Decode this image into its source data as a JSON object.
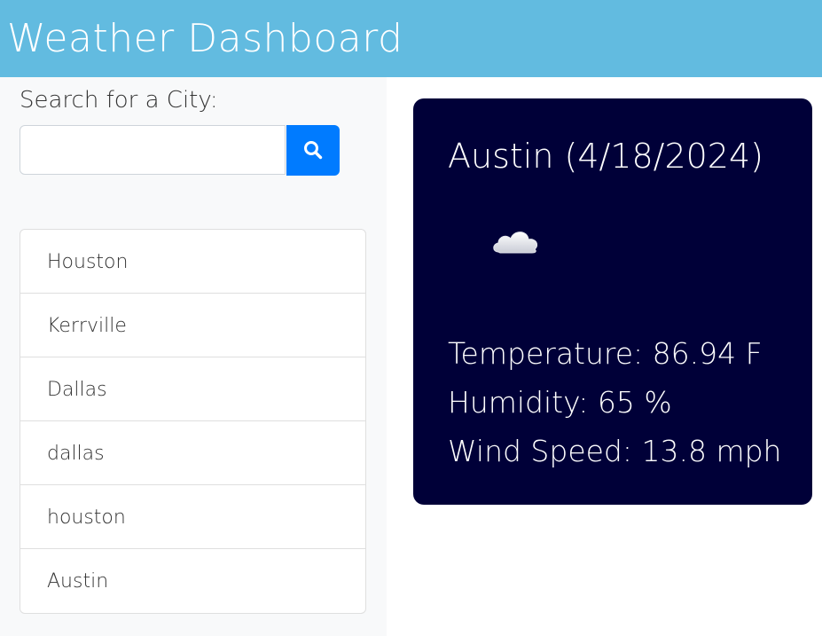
{
  "header": {
    "title": "Weather Dashboard"
  },
  "sidebar": {
    "search_label": "Search for a City:",
    "search_input": {
      "value": "",
      "placeholder": ""
    },
    "search_button_icon": "search-icon",
    "cities": [
      "Houston",
      "Kerrville",
      "Dallas",
      "dallas",
      "houston",
      "Austin"
    ]
  },
  "current": {
    "heading": "Austin (4/18/2024)",
    "icon": "cloud-icon",
    "temperature": "Temperature: 86.94 F",
    "humidity": "Humidity: 65 %",
    "wind": "Wind Speed: 13.8 mph"
  },
  "colors": {
    "header_bg": "#62bbe0",
    "card_bg": "#000038",
    "button_bg": "#007bff"
  }
}
